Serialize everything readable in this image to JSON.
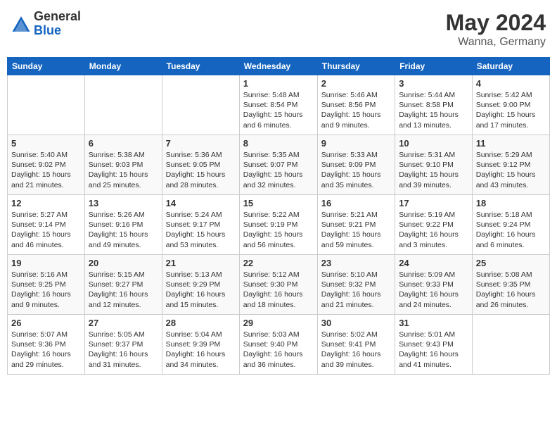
{
  "header": {
    "logo_general": "General",
    "logo_blue": "Blue",
    "month": "May 2024",
    "location": "Wanna, Germany"
  },
  "weekdays": [
    "Sunday",
    "Monday",
    "Tuesday",
    "Wednesday",
    "Thursday",
    "Friday",
    "Saturday"
  ],
  "weeks": [
    [
      {
        "day": "",
        "info": ""
      },
      {
        "day": "",
        "info": ""
      },
      {
        "day": "",
        "info": ""
      },
      {
        "day": "1",
        "info": "Sunrise: 5:48 AM\nSunset: 8:54 PM\nDaylight: 15 hours\nand 6 minutes."
      },
      {
        "day": "2",
        "info": "Sunrise: 5:46 AM\nSunset: 8:56 PM\nDaylight: 15 hours\nand 9 minutes."
      },
      {
        "day": "3",
        "info": "Sunrise: 5:44 AM\nSunset: 8:58 PM\nDaylight: 15 hours\nand 13 minutes."
      },
      {
        "day": "4",
        "info": "Sunrise: 5:42 AM\nSunset: 9:00 PM\nDaylight: 15 hours\nand 17 minutes."
      }
    ],
    [
      {
        "day": "5",
        "info": "Sunrise: 5:40 AM\nSunset: 9:02 PM\nDaylight: 15 hours\nand 21 minutes."
      },
      {
        "day": "6",
        "info": "Sunrise: 5:38 AM\nSunset: 9:03 PM\nDaylight: 15 hours\nand 25 minutes."
      },
      {
        "day": "7",
        "info": "Sunrise: 5:36 AM\nSunset: 9:05 PM\nDaylight: 15 hours\nand 28 minutes."
      },
      {
        "day": "8",
        "info": "Sunrise: 5:35 AM\nSunset: 9:07 PM\nDaylight: 15 hours\nand 32 minutes."
      },
      {
        "day": "9",
        "info": "Sunrise: 5:33 AM\nSunset: 9:09 PM\nDaylight: 15 hours\nand 35 minutes."
      },
      {
        "day": "10",
        "info": "Sunrise: 5:31 AM\nSunset: 9:10 PM\nDaylight: 15 hours\nand 39 minutes."
      },
      {
        "day": "11",
        "info": "Sunrise: 5:29 AM\nSunset: 9:12 PM\nDaylight: 15 hours\nand 43 minutes."
      }
    ],
    [
      {
        "day": "12",
        "info": "Sunrise: 5:27 AM\nSunset: 9:14 PM\nDaylight: 15 hours\nand 46 minutes."
      },
      {
        "day": "13",
        "info": "Sunrise: 5:26 AM\nSunset: 9:16 PM\nDaylight: 15 hours\nand 49 minutes."
      },
      {
        "day": "14",
        "info": "Sunrise: 5:24 AM\nSunset: 9:17 PM\nDaylight: 15 hours\nand 53 minutes."
      },
      {
        "day": "15",
        "info": "Sunrise: 5:22 AM\nSunset: 9:19 PM\nDaylight: 15 hours\nand 56 minutes."
      },
      {
        "day": "16",
        "info": "Sunrise: 5:21 AM\nSunset: 9:21 PM\nDaylight: 15 hours\nand 59 minutes."
      },
      {
        "day": "17",
        "info": "Sunrise: 5:19 AM\nSunset: 9:22 PM\nDaylight: 16 hours\nand 3 minutes."
      },
      {
        "day": "18",
        "info": "Sunrise: 5:18 AM\nSunset: 9:24 PM\nDaylight: 16 hours\nand 6 minutes."
      }
    ],
    [
      {
        "day": "19",
        "info": "Sunrise: 5:16 AM\nSunset: 9:25 PM\nDaylight: 16 hours\nand 9 minutes."
      },
      {
        "day": "20",
        "info": "Sunrise: 5:15 AM\nSunset: 9:27 PM\nDaylight: 16 hours\nand 12 minutes."
      },
      {
        "day": "21",
        "info": "Sunrise: 5:13 AM\nSunset: 9:29 PM\nDaylight: 16 hours\nand 15 minutes."
      },
      {
        "day": "22",
        "info": "Sunrise: 5:12 AM\nSunset: 9:30 PM\nDaylight: 16 hours\nand 18 minutes."
      },
      {
        "day": "23",
        "info": "Sunrise: 5:10 AM\nSunset: 9:32 PM\nDaylight: 16 hours\nand 21 minutes."
      },
      {
        "day": "24",
        "info": "Sunrise: 5:09 AM\nSunset: 9:33 PM\nDaylight: 16 hours\nand 24 minutes."
      },
      {
        "day": "25",
        "info": "Sunrise: 5:08 AM\nSunset: 9:35 PM\nDaylight: 16 hours\nand 26 minutes."
      }
    ],
    [
      {
        "day": "26",
        "info": "Sunrise: 5:07 AM\nSunset: 9:36 PM\nDaylight: 16 hours\nand 29 minutes."
      },
      {
        "day": "27",
        "info": "Sunrise: 5:05 AM\nSunset: 9:37 PM\nDaylight: 16 hours\nand 31 minutes."
      },
      {
        "day": "28",
        "info": "Sunrise: 5:04 AM\nSunset: 9:39 PM\nDaylight: 16 hours\nand 34 minutes."
      },
      {
        "day": "29",
        "info": "Sunrise: 5:03 AM\nSunset: 9:40 PM\nDaylight: 16 hours\nand 36 minutes."
      },
      {
        "day": "30",
        "info": "Sunrise: 5:02 AM\nSunset: 9:41 PM\nDaylight: 16 hours\nand 39 minutes."
      },
      {
        "day": "31",
        "info": "Sunrise: 5:01 AM\nSunset: 9:43 PM\nDaylight: 16 hours\nand 41 minutes."
      },
      {
        "day": "",
        "info": ""
      }
    ]
  ]
}
